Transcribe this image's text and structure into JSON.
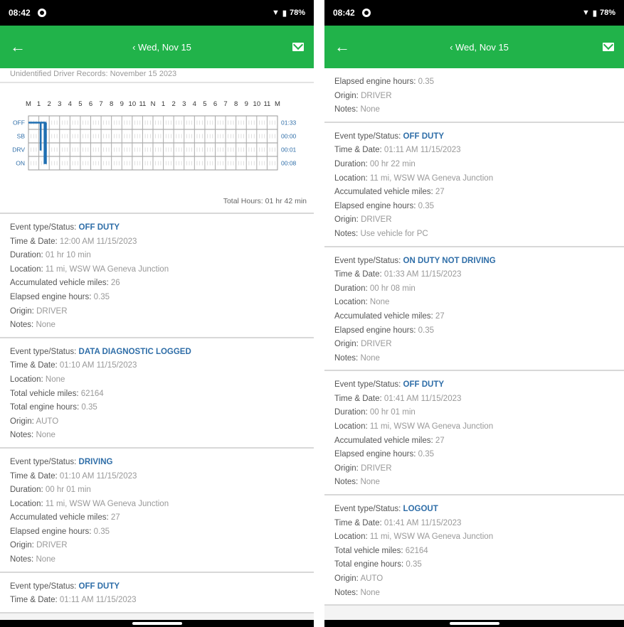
{
  "status": {
    "time": "08:42",
    "battery": "78%"
  },
  "appbar": {
    "title": "‹ Wed, Nov 15"
  },
  "left": {
    "cut_line": "Unidentified Driver Records: November 15 2023",
    "graph": {
      "hours": [
        "M",
        "1",
        "2",
        "3",
        "4",
        "5",
        "6",
        "7",
        "8",
        "9",
        "10",
        "11",
        "N",
        "1",
        "2",
        "3",
        "4",
        "5",
        "6",
        "7",
        "8",
        "9",
        "10",
        "11",
        "M"
      ],
      "rows": [
        "OFF",
        "SB",
        "DRV",
        "ON"
      ],
      "row_totals": [
        "01:33",
        "00:00",
        "00:01",
        "00:08"
      ],
      "total": "Total Hours: 01 hr 42 min"
    },
    "events": [
      {
        "status": "OFF DUTY",
        "rows": [
          {
            "k": "Time & Date:",
            "v": "12:00 AM 11/15/2023"
          },
          {
            "k": "Duration:",
            "v": "01 hr 10 min"
          },
          {
            "k": "Location:",
            "v": "11 mi, WSW WA Geneva Junction"
          },
          {
            "k": "Accumulated vehicle miles:",
            "v": "26"
          },
          {
            "k": "Elapsed engine hours:",
            "v": "0.35"
          },
          {
            "k": "Origin:",
            "v": "DRIVER"
          },
          {
            "k": "Notes:",
            "v": "None"
          }
        ]
      },
      {
        "status": "DATA DIAGNOSTIC LOGGED",
        "rows": [
          {
            "k": "Time & Date:",
            "v": "01:10 AM 11/15/2023"
          },
          {
            "k": "Location:",
            "v": "None"
          },
          {
            "k": "Total vehicle miles:",
            "v": "62164"
          },
          {
            "k": "Total engine hours:",
            "v": "0.35"
          },
          {
            "k": "Origin:",
            "v": "AUTO"
          },
          {
            "k": "Notes:",
            "v": "None"
          }
        ]
      },
      {
        "status": "DRIVING",
        "rows": [
          {
            "k": "Time & Date:",
            "v": "01:10 AM 11/15/2023"
          },
          {
            "k": "Duration:",
            "v": "00 hr 01 min"
          },
          {
            "k": "Location:",
            "v": "11 mi, WSW WA Geneva Junction"
          },
          {
            "k": "Accumulated vehicle miles:",
            "v": "27"
          },
          {
            "k": "Elapsed engine hours:",
            "v": "0.35"
          },
          {
            "k": "Origin:",
            "v": "DRIVER"
          },
          {
            "k": "Notes:",
            "v": "None"
          }
        ]
      },
      {
        "status": "OFF DUTY",
        "rows": [
          {
            "k": "Time & Date:",
            "v": "01:11 AM 11/15/2023"
          }
        ]
      }
    ]
  },
  "right": {
    "events": [
      {
        "status": "",
        "rows": [
          {
            "k": "Elapsed engine hours:",
            "v": "0.35"
          },
          {
            "k": "Origin:",
            "v": "DRIVER"
          },
          {
            "k": "Notes:",
            "v": "None"
          }
        ]
      },
      {
        "status": "OFF DUTY",
        "rows": [
          {
            "k": "Time & Date:",
            "v": "01:11 AM 11/15/2023"
          },
          {
            "k": "Duration:",
            "v": "00 hr 22 min"
          },
          {
            "k": "Location:",
            "v": "11 mi, WSW WA Geneva Junction"
          },
          {
            "k": "Accumulated vehicle miles:",
            "v": "27"
          },
          {
            "k": "Elapsed engine hours:",
            "v": "0.35"
          },
          {
            "k": "Origin:",
            "v": "DRIVER"
          },
          {
            "k": "Notes:",
            "v": "Use vehicle for PC"
          }
        ]
      },
      {
        "status": "ON DUTY NOT DRIVING",
        "rows": [
          {
            "k": "Time & Date:",
            "v": "01:33 AM 11/15/2023"
          },
          {
            "k": "Duration:",
            "v": "00 hr 08 min"
          },
          {
            "k": "Location:",
            "v": "None"
          },
          {
            "k": "Accumulated vehicle miles:",
            "v": "27"
          },
          {
            "k": "Elapsed engine hours:",
            "v": "0.35"
          },
          {
            "k": "Origin:",
            "v": "DRIVER"
          },
          {
            "k": "Notes:",
            "v": "None"
          }
        ]
      },
      {
        "status": "OFF DUTY",
        "rows": [
          {
            "k": "Time & Date:",
            "v": "01:41 AM 11/15/2023"
          },
          {
            "k": "Duration:",
            "v": "00 hr 01 min"
          },
          {
            "k": "Location:",
            "v": "11 mi, WSW WA Geneva Junction"
          },
          {
            "k": "Accumulated vehicle miles:",
            "v": "27"
          },
          {
            "k": "Elapsed engine hours:",
            "v": "0.35"
          },
          {
            "k": "Origin:",
            "v": "DRIVER"
          },
          {
            "k": "Notes:",
            "v": "None"
          }
        ]
      },
      {
        "status": "LOGOUT",
        "rows": [
          {
            "k": "Time & Date:",
            "v": "01:41 AM 11/15/2023"
          },
          {
            "k": "Location:",
            "v": "11 mi, WSW WA Geneva Junction"
          },
          {
            "k": "Total vehicle miles:",
            "v": "62164"
          },
          {
            "k": "Total engine hours:",
            "v": "0.35"
          },
          {
            "k": "Origin:",
            "v": "AUTO"
          },
          {
            "k": "Notes:",
            "v": "None"
          }
        ]
      }
    ]
  },
  "labels": {
    "event_type": "Event type/Status:"
  },
  "colors": {
    "appbar": "#21b34a",
    "status_text": "#2f6ea8",
    "graph_line": "#1f6fb2"
  }
}
